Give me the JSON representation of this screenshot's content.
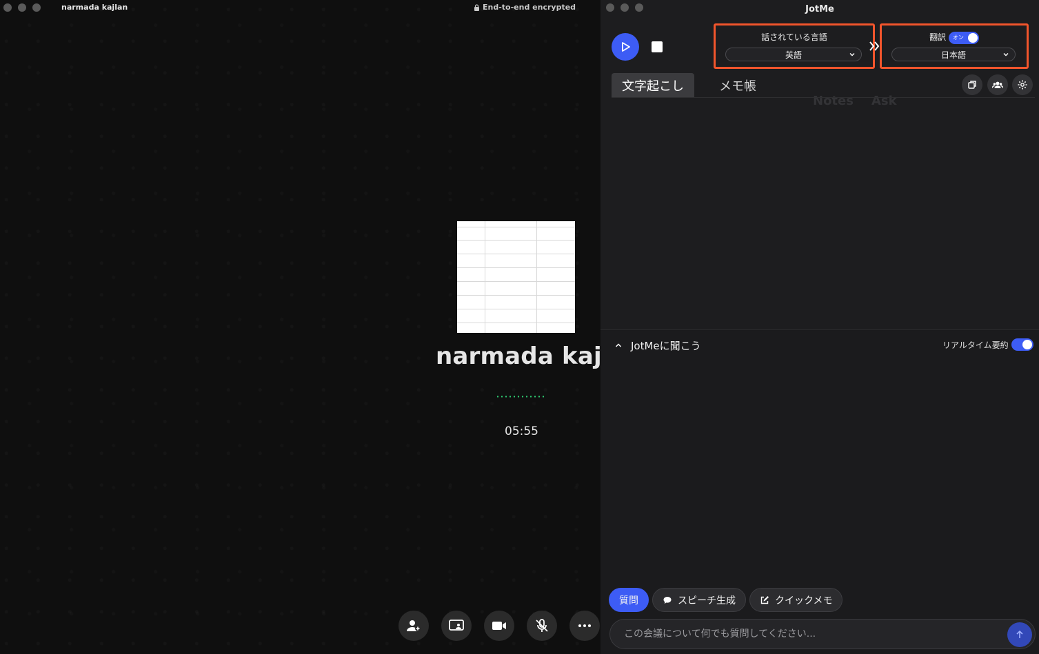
{
  "call_window": {
    "title": "narmada kajlan",
    "encryption": "End-to-end encrypted",
    "caller_name": "narmada kajlan",
    "timer": "05:55",
    "controls": [
      "add-person-icon",
      "screen-share-icon",
      "video-camera-icon",
      "mic-muted-icon",
      "more-icon"
    ]
  },
  "jotme": {
    "title": "JotMe",
    "spoken_language": {
      "label": "話されている言語",
      "value": "英語"
    },
    "translation": {
      "label": "翻訳",
      "toggle_text": "オン",
      "enabled": true,
      "value": "日本語"
    },
    "tabs": [
      {
        "label": "文字起こし",
        "active": true
      },
      {
        "label": "メモ帳",
        "active": false
      }
    ],
    "ghost_tabs": [
      "Notes",
      "Ask"
    ],
    "toolbar_icons": [
      "copy-icon",
      "people-icon",
      "gear-icon"
    ],
    "ask": {
      "title": "JotMeに聞こう",
      "realtime_summary": {
        "label": "リアルタイム要約",
        "enabled": true
      },
      "chips": [
        {
          "label": "質問",
          "icon": null,
          "active": true
        },
        {
          "label": "スピーチ生成",
          "icon": "chat-bubble-icon",
          "active": false
        },
        {
          "label": "クイックメモ",
          "icon": "edit-icon",
          "active": false
        }
      ],
      "input_placeholder": "この会議について何でも質問してください..."
    },
    "colors": {
      "accent": "#3d5cf5",
      "highlight_box": "#f2552c"
    }
  }
}
